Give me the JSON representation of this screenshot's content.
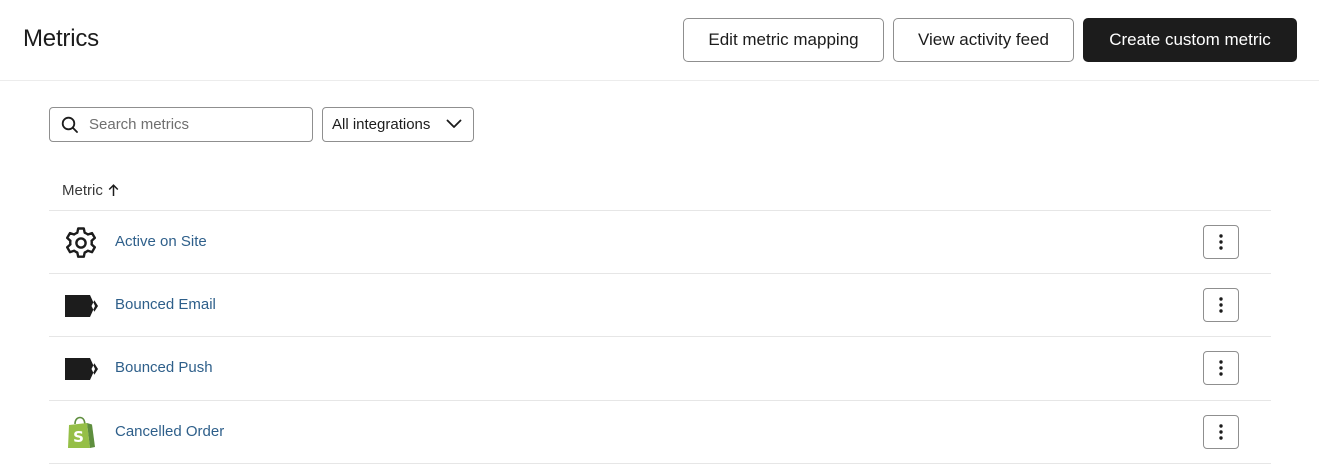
{
  "header": {
    "title": "Metrics",
    "edit_mapping_label": "Edit metric mapping",
    "activity_feed_label": "View activity feed",
    "create_label": "Create custom metric"
  },
  "filters": {
    "search_placeholder": "Search metrics",
    "search_value": "",
    "integration_selected": "All integrations"
  },
  "table": {
    "column_header": "Metric",
    "sort": "ascending",
    "rows": [
      {
        "name": "Active on Site",
        "icon": "gear-icon"
      },
      {
        "name": "Bounced Email",
        "icon": "klaviyo-flag-icon"
      },
      {
        "name": "Bounced Push",
        "icon": "klaviyo-flag-icon"
      },
      {
        "name": "Cancelled Order",
        "icon": "shopify-icon"
      }
    ]
  },
  "colors": {
    "primary_button": "#1c1c1c",
    "link": "#2e5f8a",
    "shopify_green": "#95bf47"
  }
}
